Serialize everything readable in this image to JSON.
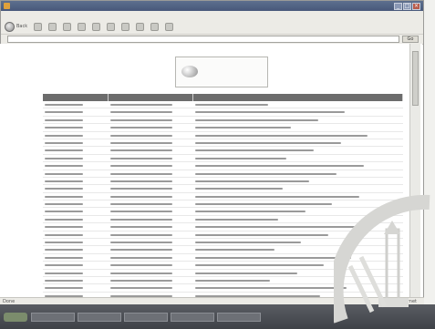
{
  "window": {
    "title": ""
  },
  "menubar": {
    "items": [
      "",
      "",
      "",
      "",
      "",
      ""
    ]
  },
  "toolbar": {
    "back_label": "Back",
    "icons": [
      "forward-icon",
      "stop-icon",
      "refresh-icon",
      "home-icon",
      "search-icon",
      "favorites-icon",
      "media-icon",
      "history-icon",
      "mail-icon",
      "print-icon"
    ]
  },
  "addressbar": {
    "label": "",
    "url": "",
    "go_label": "Go"
  },
  "banner": {
    "title": "",
    "subtitle": ""
  },
  "table": {
    "headers": [
      "",
      "",
      ""
    ],
    "rows": [
      [
        "",
        "",
        ""
      ],
      [
        "",
        "",
        ""
      ],
      [
        "",
        "",
        ""
      ],
      [
        "",
        "",
        ""
      ],
      [
        "",
        "",
        ""
      ],
      [
        "",
        "",
        ""
      ],
      [
        "",
        "",
        ""
      ],
      [
        "",
        "",
        ""
      ],
      [
        "",
        "",
        ""
      ],
      [
        "",
        "",
        ""
      ],
      [
        "",
        "",
        ""
      ],
      [
        "",
        "",
        ""
      ],
      [
        "",
        "",
        ""
      ],
      [
        "",
        "",
        ""
      ],
      [
        "",
        "",
        ""
      ],
      [
        "",
        "",
        ""
      ],
      [
        "",
        "",
        ""
      ],
      [
        "",
        "",
        ""
      ],
      [
        "",
        "",
        ""
      ],
      [
        "",
        "",
        ""
      ],
      [
        "",
        "",
        ""
      ],
      [
        "",
        "",
        ""
      ],
      [
        "",
        "",
        ""
      ],
      [
        "",
        "",
        ""
      ],
      [
        "",
        "",
        ""
      ],
      [
        "",
        "",
        ""
      ],
      [
        "",
        "",
        ""
      ]
    ]
  },
  "statusbar": {
    "text": "Done",
    "zone": "Internet"
  },
  "taskbar": {
    "start_label": "",
    "tasks": [
      "",
      "",
      "",
      "",
      ""
    ],
    "clock": ""
  },
  "colors": {
    "titlebar": "#5d6f8e",
    "header_row": "#6c6c6c",
    "taskbar": "#4c4f54"
  }
}
